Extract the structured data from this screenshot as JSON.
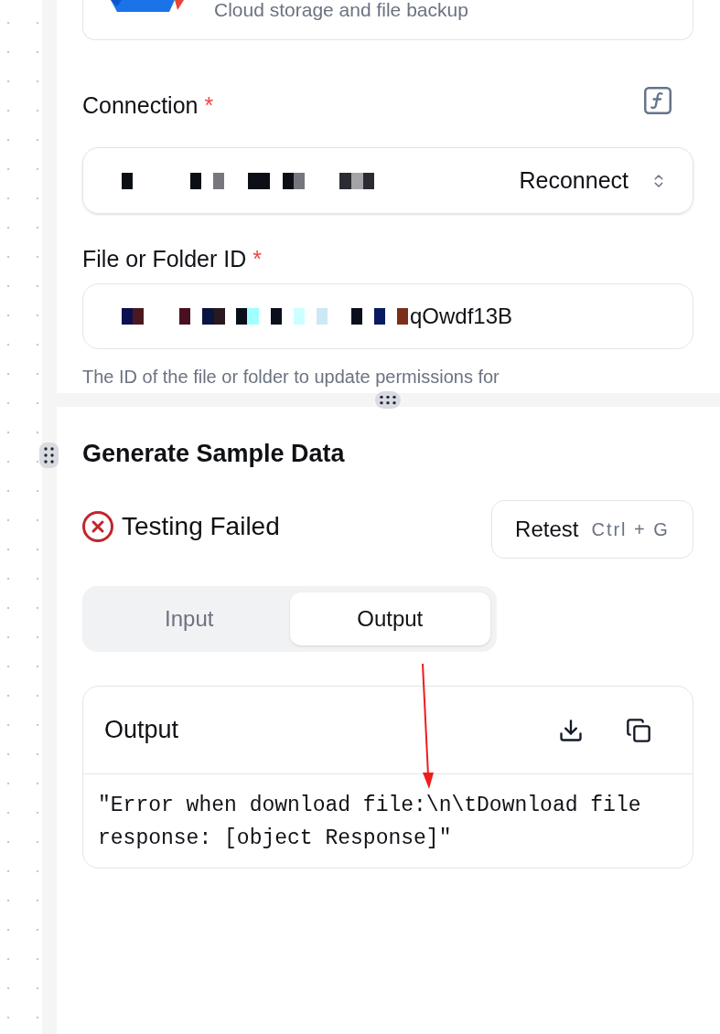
{
  "app_card": {
    "description": "Cloud storage and file backup"
  },
  "connection": {
    "label": "Connection",
    "required_mark": "*",
    "action": "Reconnect"
  },
  "file_id": {
    "label": "File or Folder ID",
    "required_mark": "*",
    "value": "qOwdf13B",
    "hint": "The ID of the file or folder to update permissions for"
  },
  "sample_data": {
    "title": "Generate Sample Data",
    "status": {
      "kind": "failed",
      "text": "Testing Failed"
    },
    "retest": {
      "label": "Retest",
      "shortcut": "Ctrl + G"
    },
    "tabs": [
      {
        "label": "Input",
        "selected": false
      },
      {
        "label": "Output",
        "selected": true
      }
    ],
    "output": {
      "title": "Output",
      "text": "\"Error when download file:\\n\\tDownload file response: [object Response]\""
    }
  }
}
